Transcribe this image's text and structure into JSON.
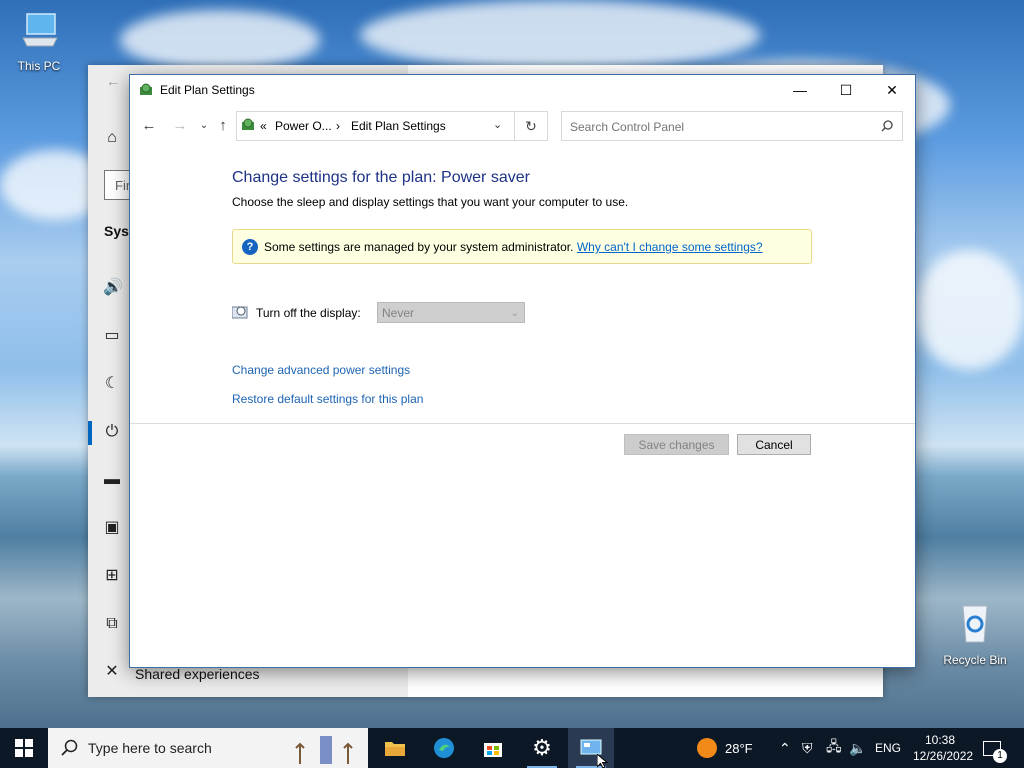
{
  "desktop": {
    "this_pc_label": "This PC",
    "recycle_bin_label": "Recycle Bin"
  },
  "settings_window": {
    "search_partial": "Fir",
    "section_partial": "Syst",
    "shared_experiences": "Shared experiences"
  },
  "window": {
    "title": "Edit Plan Settings",
    "minimize": "—",
    "maximize": "☐",
    "close": "✕"
  },
  "address_bar": {
    "separator": "«",
    "crumb1": "Power O...",
    "crumb_sep": "›",
    "crumb2": "Edit Plan Settings"
  },
  "search": {
    "placeholder": "Search Control Panel"
  },
  "content": {
    "heading": "Change settings for the plan: Power saver",
    "subheading": "Choose the sleep and display settings that you want your computer to use.",
    "info_message": "Some settings are managed by your system administrator.",
    "info_link": "Why can't I change some settings?",
    "display_label": "Turn off the display:",
    "display_value": "Never",
    "link_advanced": "Change advanced power settings",
    "link_restore": "Restore default settings for this plan",
    "save_button": "Save changes",
    "cancel_button": "Cancel"
  },
  "taskbar": {
    "search_placeholder": "Type here to search",
    "weather": "28°F",
    "language": "ENG",
    "time": "10:38",
    "date": "12/26/2022",
    "notification_count": "1"
  },
  "colors": {
    "heading": "#1e3287",
    "link": "#1e64b4",
    "info_bg": "#ffffe1",
    "taskbar": "#0d1826"
  }
}
